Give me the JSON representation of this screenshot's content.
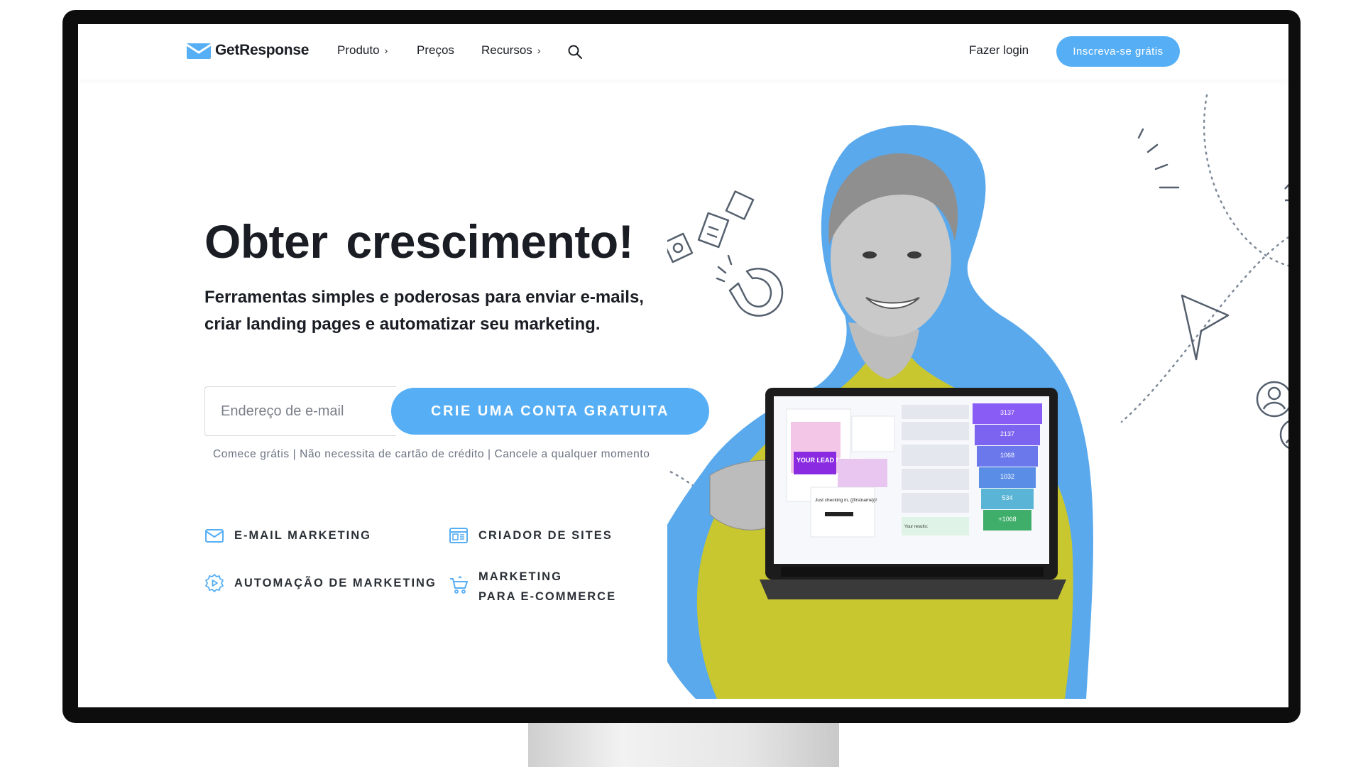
{
  "brand": {
    "name": "GetResponse",
    "accent": "#56aef5",
    "highlight": "#f8e833"
  },
  "nav": {
    "items": [
      {
        "label": "Produto",
        "has_chevron": true,
        "chevron": "›"
      },
      {
        "label": "Preços",
        "has_chevron": false
      },
      {
        "label": "Recursos",
        "has_chevron": true,
        "chevron": "›"
      }
    ],
    "login": "Fazer login",
    "signup": "Inscreva-se grátis"
  },
  "hero": {
    "headline_plain": "Obter",
    "headline_highlight": "crescimento!",
    "subhead_line1": "Ferramentas simples e poderosas para enviar e-mails,",
    "subhead_line2": "criar landing pages e automatizar seu marketing.",
    "email_placeholder": "Endereço de e-mail",
    "cta": "CRIE UMA CONTA GRATUITA",
    "fineprint": "Comece grátis | Não necessita de cartão de crédito | Cancele a qualquer momento"
  },
  "features": [
    {
      "label": "E-MAIL MARKETING",
      "icon": "envelope-icon"
    },
    {
      "label": "CRIADOR DE SITES",
      "icon": "website-icon"
    },
    {
      "label": "AUTOMAÇÃO DE MARKETING",
      "icon": "automation-gear-icon"
    },
    {
      "label_line1": "MARKETING",
      "label_line2": "PARA E-COMMERCE",
      "icon": "shopping-cart-icon"
    }
  ],
  "laptop": {
    "funnel_values": [
      "3137",
      "2137",
      "1068",
      "1032",
      "534",
      "+1068"
    ],
    "funnel_colors": [
      "#8a5cf6",
      "#7d64f0",
      "#6a78ec",
      "#5a8ee6",
      "#59b4d6",
      "#3fae6a"
    ],
    "lead_magnet_text": "YOUR LEAD MAGNET",
    "checking_text": "Just checking in, {{firstname}}!",
    "results_label": "Your results:"
  }
}
